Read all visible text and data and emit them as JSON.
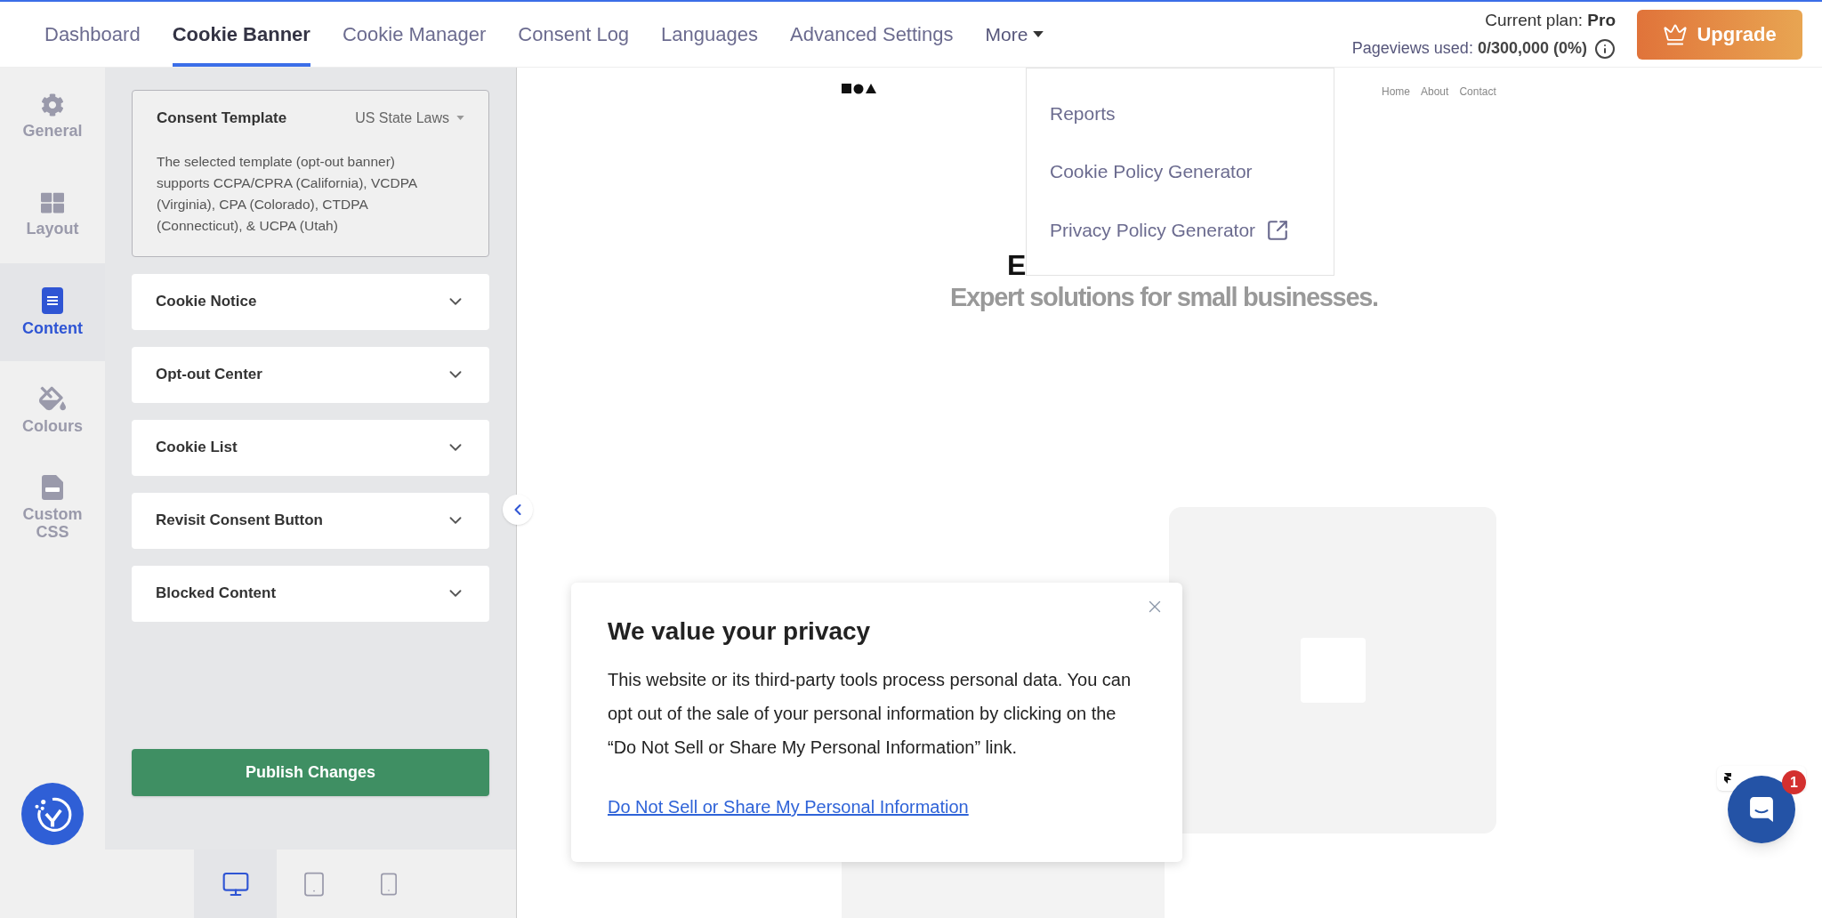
{
  "nav": {
    "tabs": [
      {
        "label": "Dashboard",
        "selected": false
      },
      {
        "label": "Cookie Banner",
        "selected": true
      },
      {
        "label": "Cookie Manager",
        "selected": false
      },
      {
        "label": "Consent Log",
        "selected": false
      },
      {
        "label": "Languages",
        "selected": false
      },
      {
        "label": "Advanced Settings",
        "selected": false
      }
    ],
    "more": {
      "label": "More",
      "expanded": true,
      "items": [
        {
          "label": "Reports",
          "external": false
        },
        {
          "label": "Cookie Policy Generator",
          "external": false
        },
        {
          "label": "Privacy Policy Generator",
          "external": true
        }
      ]
    },
    "plan": {
      "label": "Current plan:",
      "value": "Pro"
    },
    "pageviews": {
      "label": "Pageviews used:",
      "value": "0/300,000 (0%)"
    },
    "upgrade": "Upgrade"
  },
  "rail": {
    "items": [
      {
        "label": "General",
        "selected": false
      },
      {
        "label": "Layout",
        "selected": false
      },
      {
        "label": "Content",
        "selected": true
      },
      {
        "label": "Colours",
        "selected": false
      },
      {
        "label": "Custom CSS",
        "selected": false
      }
    ]
  },
  "panel": {
    "template": {
      "title": "Consent Template",
      "value": "US State Laws",
      "description": "The selected template (opt-out banner) supports CCPA/CPRA (California), VCDPA (Virginia), CPA (Colorado), CTDPA (Connecticut), & UCPA (Utah)"
    },
    "sections": [
      {
        "title": "Cookie Notice",
        "expanded": false
      },
      {
        "title": "Opt-out Center",
        "expanded": false
      },
      {
        "title": "Cookie List",
        "expanded": false
      },
      {
        "title": "Revisit Consent Button",
        "expanded": false
      },
      {
        "title": "Blocked Content",
        "expanded": false
      }
    ],
    "publish": "Publish Changes",
    "devices": [
      {
        "selected": true
      },
      {
        "selected": false
      },
      {
        "selected": false
      }
    ]
  },
  "preview": {
    "site": {
      "nav_links": [
        "Home",
        "About",
        "Contact"
      ],
      "heading_fragment": "E",
      "subheading": "Expert solutions for small businesses."
    },
    "banner": {
      "title": "We value your privacy",
      "body": "This website or its third-party tools process personal data. You can opt out of the sale of your personal information by clicking on the “Do Not Sell or Share My Personal Information” link.",
      "link": "Do Not Sell or Share My Personal Information"
    },
    "chat": {
      "badge": "1"
    }
  }
}
